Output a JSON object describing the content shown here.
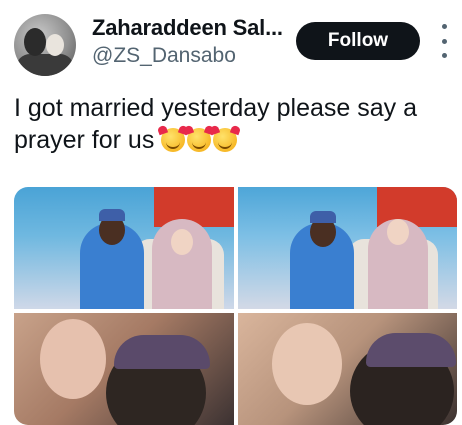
{
  "user": {
    "display_name": "Zaharaddeen Sal...",
    "handle": "@ZS_Dansabo",
    "avatar_icon": "profile-photo"
  },
  "actions": {
    "follow_label": "Follow",
    "more_icon": "more-vertical-icon"
  },
  "tweet": {
    "text_line1": "I got married yesterday please say a",
    "text_line2": "prayer for us",
    "emoji_icon": "smiling-face-with-hearts",
    "emoji_count": 3
  },
  "media": {
    "photos": [
      "wedding-photo-1",
      "wedding-photo-2",
      "selfie-photo-1",
      "selfie-photo-2"
    ]
  },
  "colors": {
    "follow_bg": "#0f1419",
    "follow_text": "#ffffff",
    "secondary_text": "#536471"
  }
}
